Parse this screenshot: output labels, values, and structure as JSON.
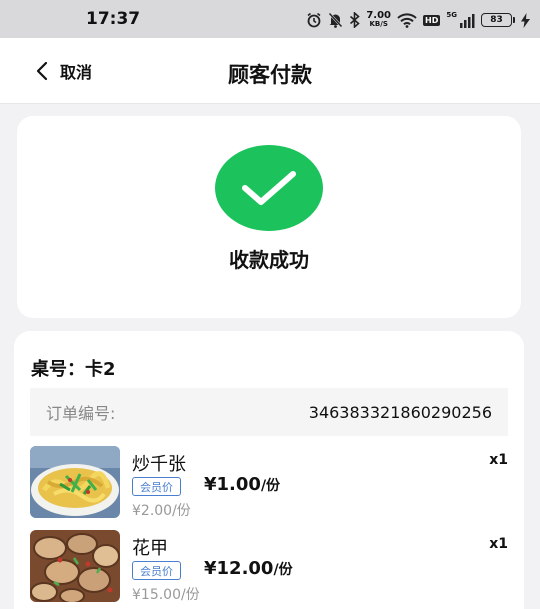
{
  "status_bar": {
    "time": "17:37",
    "net_speed_value": "7.00",
    "net_speed_unit": "KB/S",
    "hd_label": "HD",
    "signal_label": "5G",
    "battery": "83"
  },
  "nav": {
    "back_label": "取消",
    "title": "顾客付款"
  },
  "success": {
    "message": "收款成功",
    "accent_color": "#1cc35c"
  },
  "order": {
    "table_label": "桌号：卡2",
    "order_no_label": "订单编号:",
    "order_no": "346383321860290256",
    "items": [
      {
        "name": "炒千张",
        "qty": "x1",
        "member_badge": "会员价",
        "member_price": "¥1.00",
        "member_unit": "/份",
        "original_price": "¥2.00/份"
      },
      {
        "name": "花甲",
        "qty": "x1",
        "member_badge": "会员价",
        "member_price": "¥12.00",
        "member_unit": "/份",
        "original_price": "¥15.00/份"
      }
    ]
  }
}
